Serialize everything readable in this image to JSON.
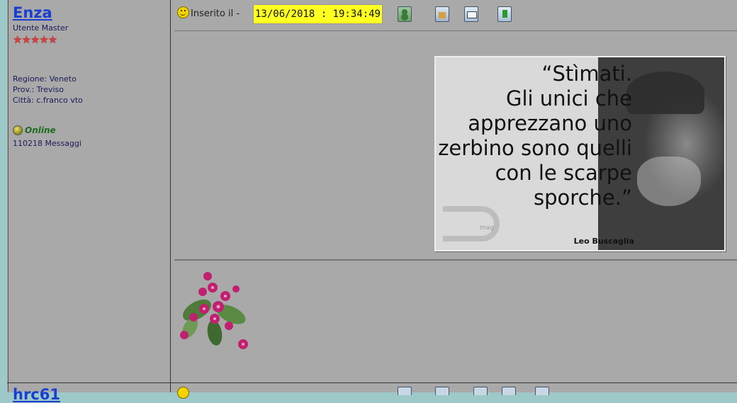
{
  "post": {
    "author": {
      "name": "Enza",
      "rank": "Utente Master",
      "stars": "★★★★★",
      "region": "Regione: Veneto",
      "province": "Prov.: Treviso",
      "city": "Città: c.franco vto",
      "status": "Online",
      "messages": "110218 Messaggi"
    },
    "header": {
      "inserted_label": "Inserito il -",
      "timestamp": "13/06/2018 : 19:34:49",
      "icons": [
        "profile-icon",
        "home-icon",
        "email-icon",
        "bookmark-icon"
      ]
    },
    "quote_image": {
      "text_lines": [
        "“Stìmati.",
        "Gli unici che",
        "apprezzano uno",
        "zerbino sono quelli",
        "con le scarpe",
        "sporche.”"
      ],
      "author": "Leo Buscaglia",
      "logo_text": "mag"
    },
    "signature": {
      "image": "violet-flowers-bouquet"
    }
  },
  "next_post": {
    "author_name_partial": "hrc61"
  },
  "colors": {
    "author_link": "#1a3fd0",
    "date_highlight": "#ffff22",
    "online": "#1d6b1d",
    "background": "#a9a9a9",
    "page_edge": "#9ec9c9"
  }
}
